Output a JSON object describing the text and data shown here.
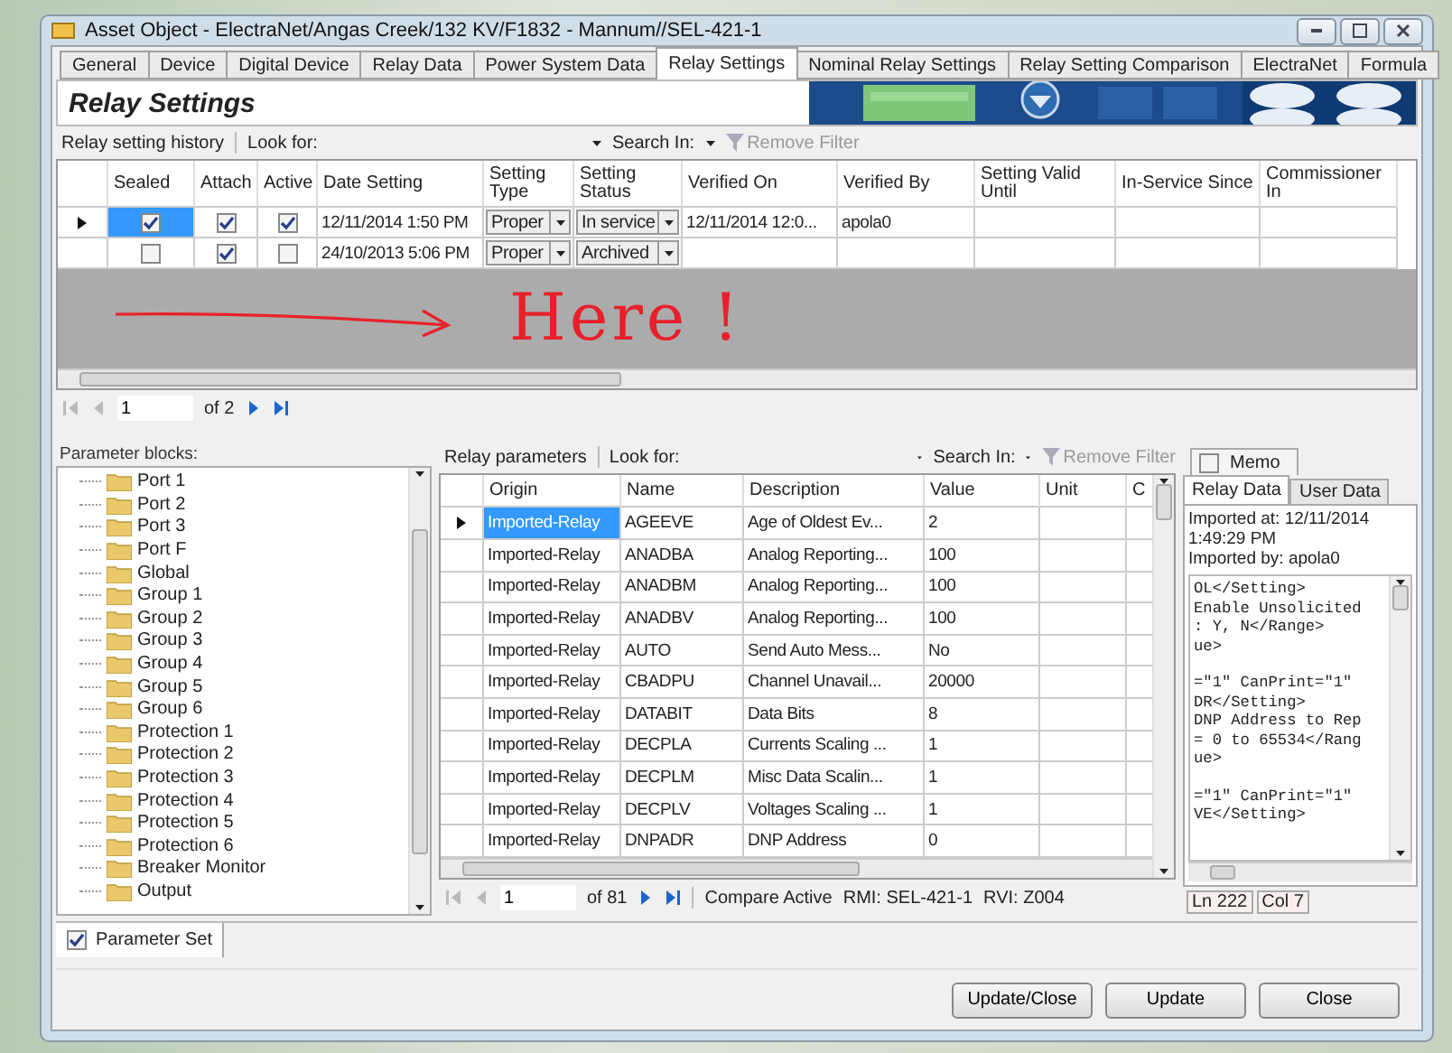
{
  "window": {
    "title": "Asset Object - ElectraNet/Angas Creek/132 KV/F1832 - Mannum//SEL-421-1"
  },
  "tabs": [
    {
      "label": "General",
      "selected": false
    },
    {
      "label": "Device",
      "selected": false
    },
    {
      "label": "Digital Device",
      "selected": false
    },
    {
      "label": "Relay Data",
      "selected": false
    },
    {
      "label": "Power System Data",
      "selected": false
    },
    {
      "label": "Relay Settings",
      "selected": true
    },
    {
      "label": "Nominal Relay Settings",
      "selected": false
    },
    {
      "label": "Relay Setting Comparison",
      "selected": false
    },
    {
      "label": "ElectraNet",
      "selected": false
    },
    {
      "label": "Formula",
      "selected": false
    }
  ],
  "header": {
    "title": "Relay Settings"
  },
  "history_toolbar": {
    "label": "Relay setting history",
    "look_for": "Look for:",
    "search_in": "Search In:",
    "remove_filter": "Remove Filter"
  },
  "history_table": {
    "columns": [
      "Sealed",
      "Attach",
      "Active",
      "Date Setting",
      "Setting Type",
      "Setting Status",
      "Verified On",
      "Verified By",
      "Setting Valid Until",
      "In-Service Since",
      "Commissioner In"
    ],
    "rows": [
      {
        "selected": true,
        "sealed": true,
        "attach": true,
        "active": true,
        "date_setting": "12/11/2014 1:50 PM",
        "setting_type": "Proper",
        "setting_status": "In service",
        "verified_on": "12/11/2014 12:0...",
        "verified_by": "apola0"
      },
      {
        "selected": false,
        "sealed": false,
        "attach": true,
        "active": false,
        "date_setting": "24/10/2013 5:06 PM",
        "setting_type": "Proper",
        "setting_status": "Archived"
      }
    ]
  },
  "annotation": {
    "text": "Here !"
  },
  "history_pager": {
    "page": "1",
    "of": "of 2"
  },
  "parameter_blocks": {
    "label": "Parameter blocks:",
    "items": [
      "Port 1",
      "Port 2",
      "Port 3",
      "Port F",
      "Global",
      "Group 1",
      "Group 2",
      "Group 3",
      "Group 4",
      "Group 5",
      "Group 6",
      "Protection 1",
      "Protection 2",
      "Protection 3",
      "Protection 4",
      "Protection 5",
      "Protection 6",
      "Breaker Monitor",
      "Output"
    ]
  },
  "parameters_toolbar": {
    "label": "Relay parameters",
    "look_for": "Look for:",
    "search_in": "Search In:",
    "remove_filter": "Remove Filter"
  },
  "parameters_table": {
    "columns": [
      "Origin",
      "Name",
      "Description",
      "Value",
      "Unit",
      "C"
    ],
    "rows": [
      {
        "selected": true,
        "origin": "Imported-Relay",
        "name": "AGEEVE",
        "description": "Age of Oldest Ev...",
        "value": "2"
      },
      {
        "selected": false,
        "origin": "Imported-Relay",
        "name": "ANADBA",
        "description": "Analog Reporting...",
        "value": "100"
      },
      {
        "selected": false,
        "origin": "Imported-Relay",
        "name": "ANADBM",
        "description": "Analog Reporting...",
        "value": "100"
      },
      {
        "selected": false,
        "origin": "Imported-Relay",
        "name": "ANADBV",
        "description": "Analog Reporting...",
        "value": "100"
      },
      {
        "selected": false,
        "origin": "Imported-Relay",
        "name": "AUTO",
        "description": "Send Auto Mess...",
        "value": "No"
      },
      {
        "selected": false,
        "origin": "Imported-Relay",
        "name": "CBADPU",
        "description": "Channel Unavail...",
        "value": "20000"
      },
      {
        "selected": false,
        "origin": "Imported-Relay",
        "name": "DATABIT",
        "description": "Data Bits",
        "value": "8"
      },
      {
        "selected": false,
        "origin": "Imported-Relay",
        "name": "DECPLA",
        "description": "Currents Scaling ...",
        "value": "1"
      },
      {
        "selected": false,
        "origin": "Imported-Relay",
        "name": "DECPLM",
        "description": "Misc Data Scalin...",
        "value": "1"
      },
      {
        "selected": false,
        "origin": "Imported-Relay",
        "name": "DECPLV",
        "description": "Voltages Scaling ...",
        "value": "1"
      },
      {
        "selected": false,
        "origin": "Imported-Relay",
        "name": "DNPADR",
        "description": "DNP Address",
        "value": "0"
      }
    ]
  },
  "parameters_pager": {
    "page": "1",
    "of": "of 81",
    "status": "Compare Active",
    "rmi": "RMI: SEL-421-1",
    "rvi": "RVI: Z004"
  },
  "memo": {
    "label": "Memo",
    "checked": false
  },
  "side_tabs": [
    {
      "label": "Relay Data",
      "selected": true
    },
    {
      "label": "User Data",
      "selected": false
    }
  ],
  "import_info": {
    "imported_at": "Imported at: 12/11/2014 1:49:29 PM",
    "imported_by": "Imported by: apola0"
  },
  "code_blocks": [
    [
      "OL</Setting>",
      "Enable Unsolicited",
      ": Y, N</Range>",
      "ue>"
    ],
    [
      "=\"1\" CanPrint=\"1\"",
      "DR</Setting>",
      "DNP Address to Rep",
      "= 0 to 65534</Rang",
      "ue>"
    ],
    [
      "=\"1\" CanPrint=\"1\"",
      "VE</Setting>"
    ]
  ],
  "cursor": {
    "line": "Ln 222",
    "col": "Col 7"
  },
  "bottom_tabs": [
    {
      "label": "Parameter Set",
      "checked": true
    }
  ],
  "buttons": [
    "Update/Close",
    "Update",
    "Close"
  ]
}
